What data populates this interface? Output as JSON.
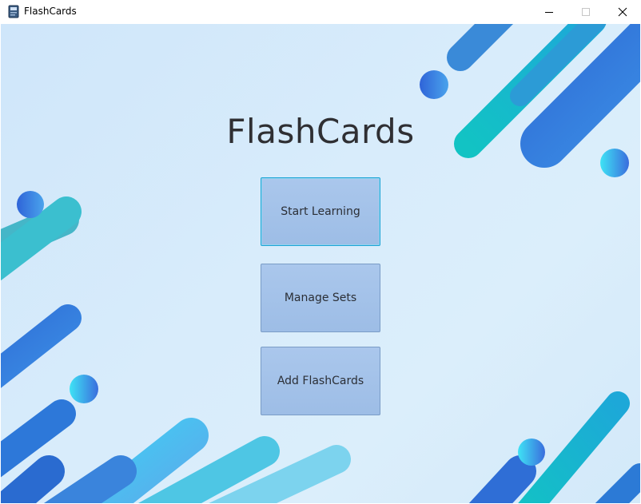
{
  "window": {
    "title": "FlashCards",
    "controls": {
      "minimize_glyph": "─",
      "maximize_glyph": "☐",
      "close_glyph": "✕"
    },
    "icon": "flashcards-app-icon"
  },
  "main": {
    "heading": "FlashCards",
    "buttons": [
      {
        "label": "Start Learning",
        "focused": true
      },
      {
        "label": "Manage Sets",
        "focused": false
      },
      {
        "label": "Add FlashCards",
        "focused": false
      }
    ]
  },
  "colors": {
    "background": "#d6ebfa",
    "button_fill": "#a3c2ea",
    "button_focus_border": "#1ea4d6",
    "heading_text": "#2f2f33",
    "decor_blue": "#3576d9",
    "decor_teal": "#17bcc9",
    "decor_cyan": "#45d3f0"
  }
}
